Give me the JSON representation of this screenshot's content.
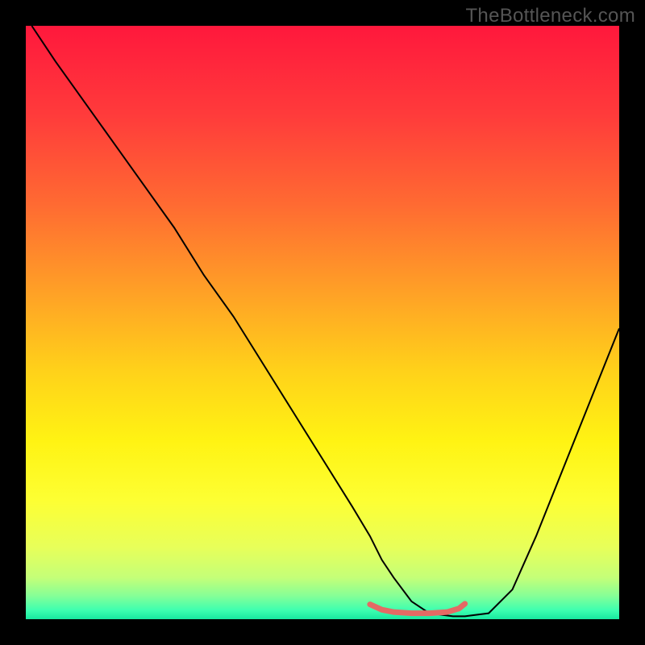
{
  "watermark": "TheBottleneck.com",
  "chart_data": {
    "type": "line",
    "title": "",
    "xlabel": "",
    "ylabel": "",
    "xlim": [
      0,
      100
    ],
    "ylim": [
      0,
      100
    ],
    "gradient_stops": [
      {
        "offset": 0.0,
        "color": "#ff183c"
      },
      {
        "offset": 0.15,
        "color": "#ff3b3b"
      },
      {
        "offset": 0.3,
        "color": "#ff6a32"
      },
      {
        "offset": 0.45,
        "color": "#ffa126"
      },
      {
        "offset": 0.58,
        "color": "#ffd11a"
      },
      {
        "offset": 0.7,
        "color": "#fff313"
      },
      {
        "offset": 0.8,
        "color": "#fdff33"
      },
      {
        "offset": 0.88,
        "color": "#e7ff5a"
      },
      {
        "offset": 0.93,
        "color": "#c4ff78"
      },
      {
        "offset": 0.96,
        "color": "#87ff96"
      },
      {
        "offset": 0.985,
        "color": "#3dffb0"
      },
      {
        "offset": 1.0,
        "color": "#18e8a0"
      }
    ],
    "series": [
      {
        "name": "curve",
        "color": "#000000",
        "stroke_width": 2,
        "x": [
          1,
          5,
          10,
          15,
          20,
          25,
          30,
          35,
          40,
          45,
          50,
          55,
          58,
          60,
          62,
          65,
          68,
          72,
          74,
          78,
          82,
          86,
          90,
          94,
          98,
          100
        ],
        "y": [
          100,
          94,
          87,
          80,
          73,
          66,
          58,
          51,
          43,
          35,
          27,
          19,
          14,
          10,
          7,
          3,
          1,
          0.5,
          0.5,
          1,
          5,
          14,
          24,
          34,
          44,
          49
        ]
      },
      {
        "name": "optimal-marker",
        "color": "#e46a64",
        "stroke_width": 7,
        "x": [
          58,
          60,
          62,
          65,
          68,
          71,
          73,
          74
        ],
        "y": [
          2.5,
          1.6,
          1.2,
          1.0,
          1.0,
          1.2,
          1.8,
          2.6
        ]
      }
    ]
  }
}
